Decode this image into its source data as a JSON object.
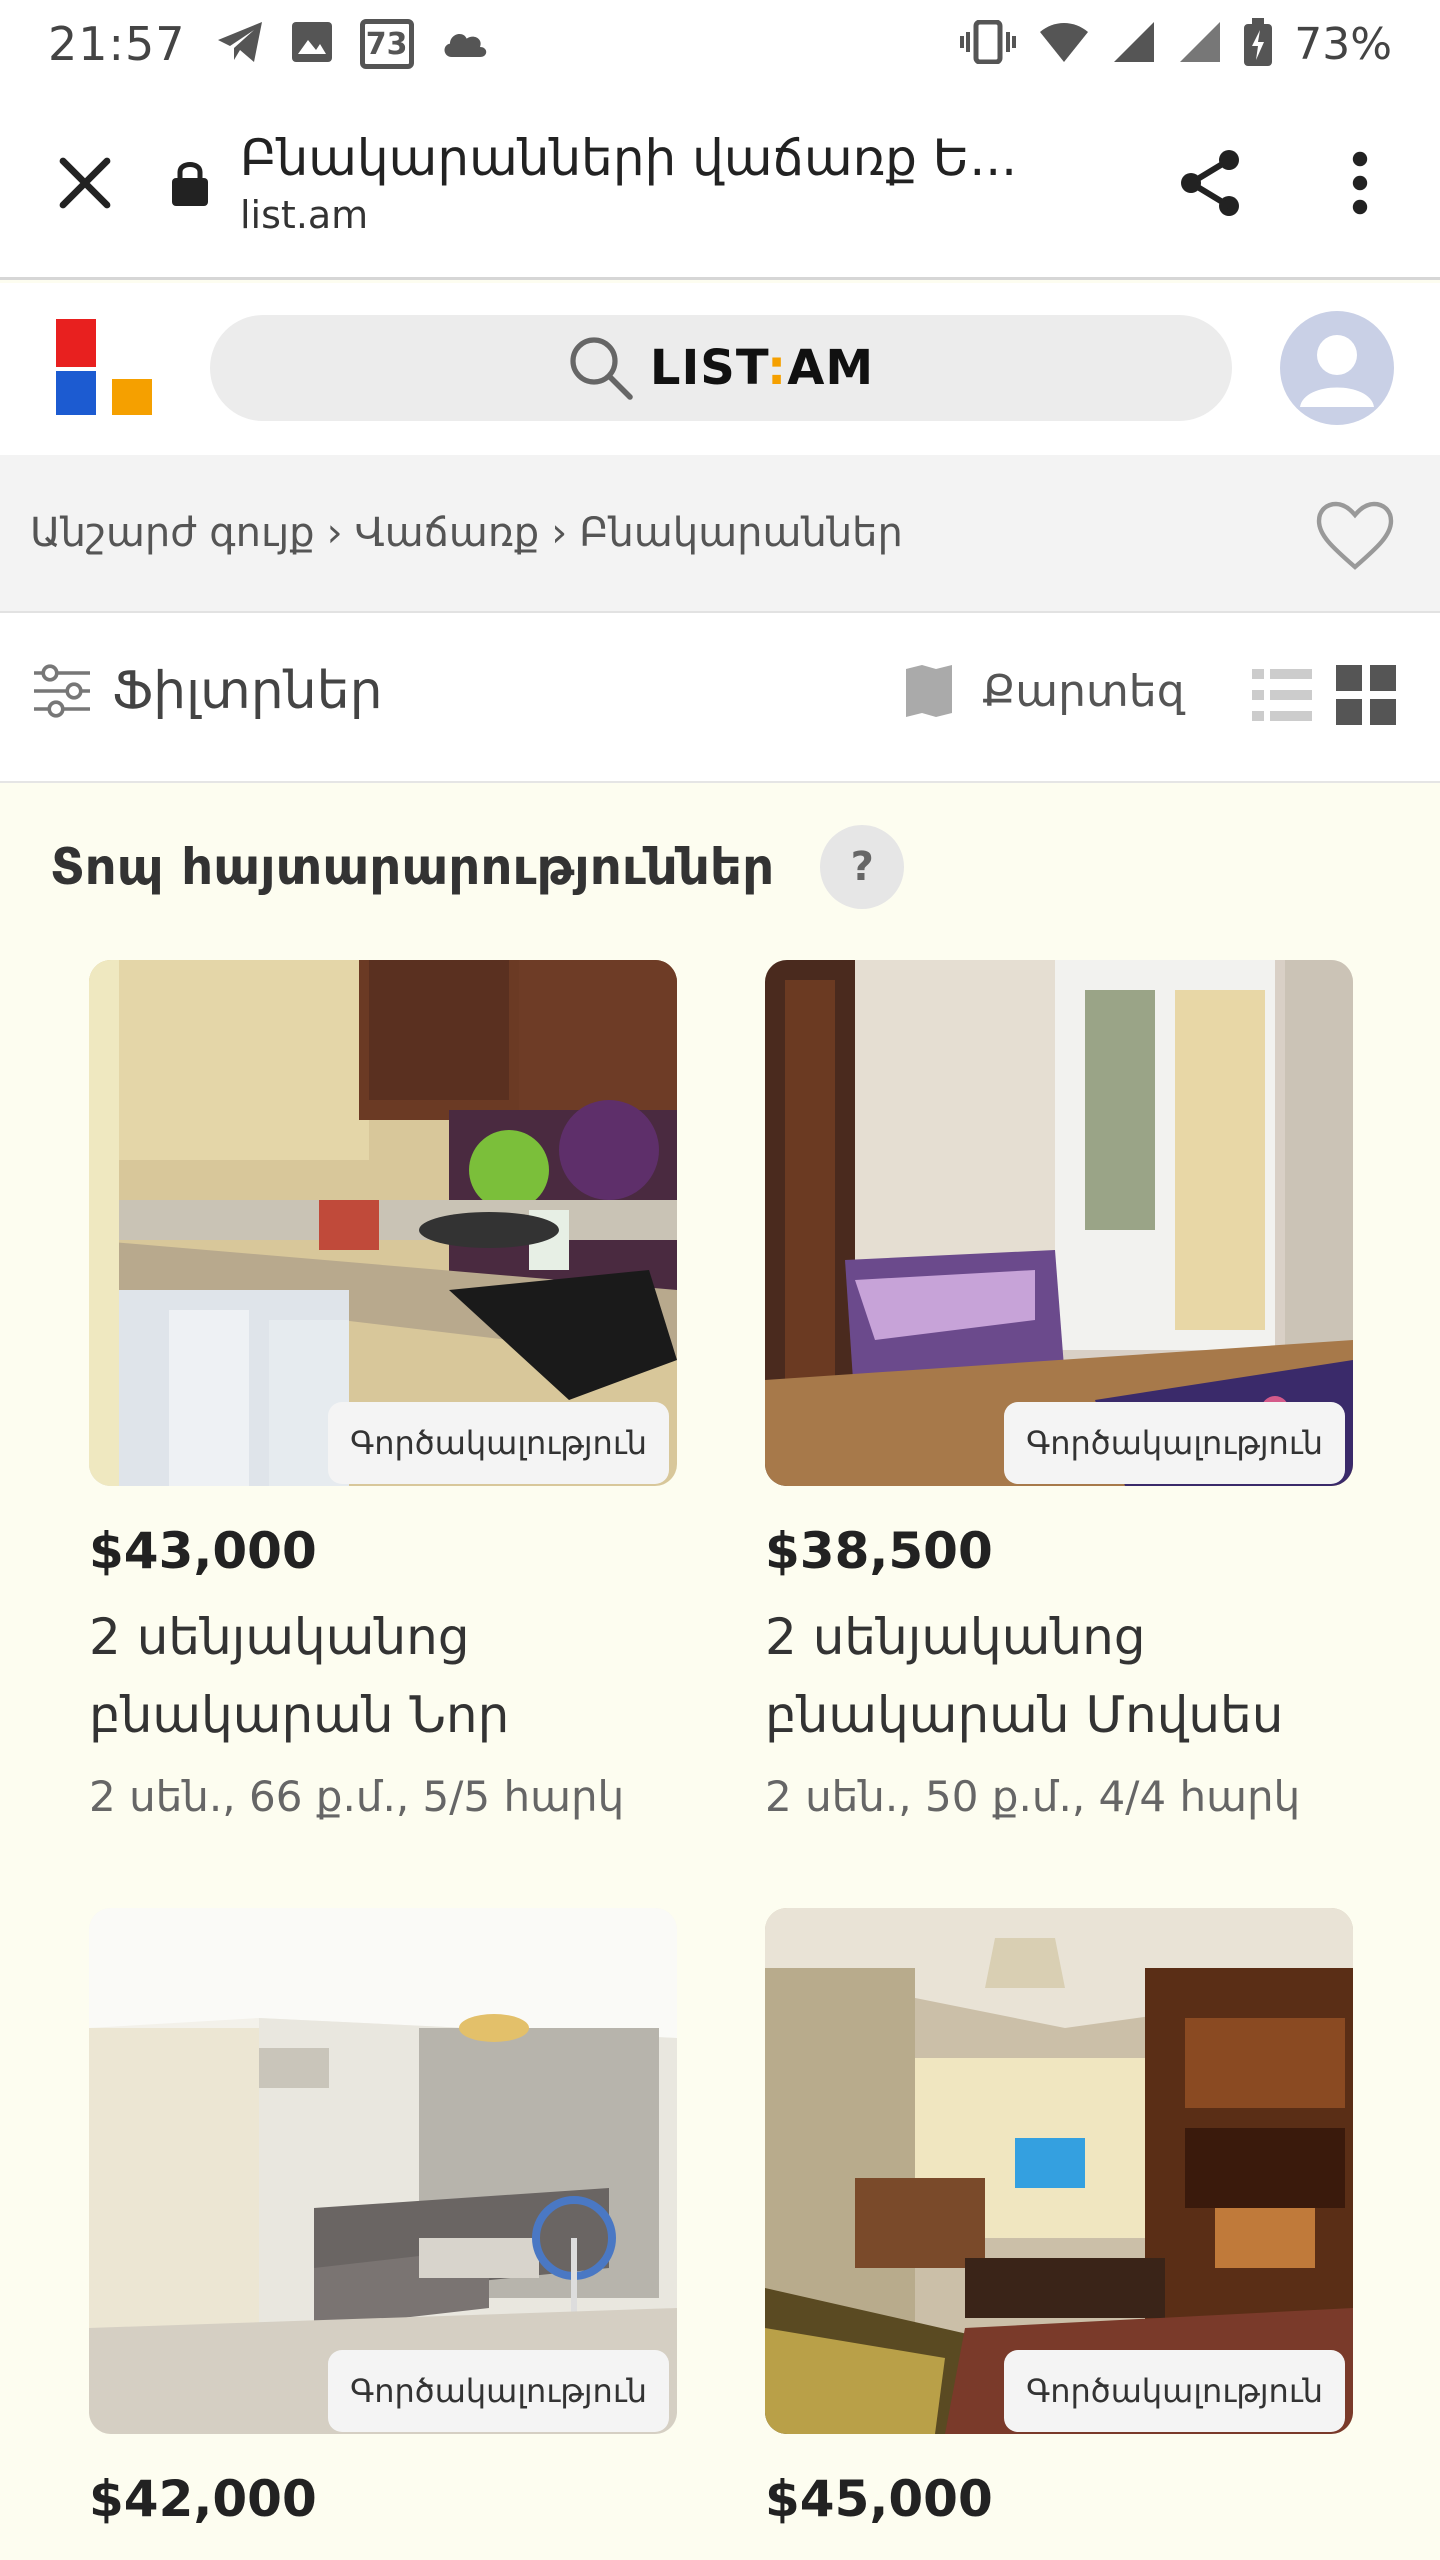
{
  "status_bar": {
    "time": "21:57",
    "notification_badge": "73",
    "battery_percent": "73%",
    "icons": [
      "telegram-icon",
      "image-icon",
      "badge-73-icon",
      "cloud-icon",
      "vibrate-icon",
      "wifi-icon",
      "signal-icon",
      "signal-icon",
      "battery-icon"
    ]
  },
  "browser": {
    "page_title": "Բնակարանների վաճառք Ե...",
    "domain": "list.am"
  },
  "header": {
    "search_brand_left": "LIST",
    "search_brand_right": "AM",
    "logo_colors": [
      "#e8201f",
      "#1c5bd1",
      "#f5a000"
    ],
    "accent_colon": "#f5a000"
  },
  "breadcrumb": {
    "items": [
      "Անշարժ գույք",
      "Վաճառք",
      "Բնակարաններ"
    ],
    "separator": "›"
  },
  "filters": {
    "filters_label": "Ֆիլտրներ",
    "map_label": "Քարտեզ"
  },
  "top_listings": {
    "title": "Տոպ հայտարարություններ",
    "help": "?",
    "cards": [
      {
        "badge": "Գործակալություն",
        "price": "$43,000",
        "title": "2 սենյականոց բնակարան Նոր",
        "meta": "2 սեն., 66 ք.մ., 5/5 հարկ"
      },
      {
        "badge": "Գործակալություն",
        "price": "$38,500",
        "title": "2 սենյականոց բնակարան Մովսես",
        "meta": "2 սեն., 50 ք.մ., 4/4 հարկ"
      },
      {
        "badge": "Գործակալություն",
        "price": "$42,000"
      },
      {
        "badge": "Գործակալություն",
        "price": "$45,000"
      }
    ]
  }
}
